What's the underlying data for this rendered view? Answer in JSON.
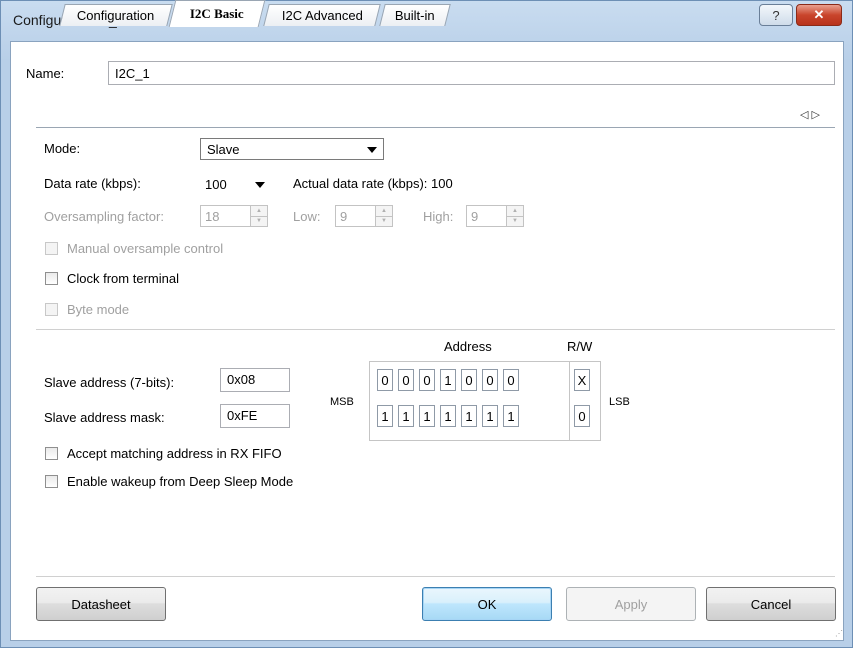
{
  "window": {
    "title": "Configure 'SCB_P4'",
    "help_glyph": "?",
    "close_glyph": "✕"
  },
  "name": {
    "label": "Name:",
    "value": "I2C_1"
  },
  "tabs": [
    {
      "label": "Configuration",
      "active": false
    },
    {
      "label": "I2C Basic",
      "active": true
    },
    {
      "label": "I2C Advanced",
      "active": false
    },
    {
      "label": "Built-in",
      "active": false
    }
  ],
  "tab_nav": {
    "left": "◁",
    "right": "▷"
  },
  "mode": {
    "label": "Mode:",
    "value": "Slave"
  },
  "data_rate": {
    "label": "Data rate (kbps):",
    "value": "100",
    "actual_label": "Actual data rate (kbps): 100"
  },
  "oversampling": {
    "label": "Oversampling factor:",
    "value": "18",
    "low_label": "Low:",
    "low_value": "9",
    "high_label": "High:",
    "high_value": "9"
  },
  "checkboxes": {
    "manual_oversample": "Manual oversample control",
    "clock_from_terminal": "Clock from terminal",
    "byte_mode": "Byte mode",
    "accept_matching": "Accept matching address in RX FIFO",
    "enable_wakeup": "Enable wakeup from Deep Sleep Mode"
  },
  "address": {
    "header_address": "Address",
    "header_rw": "R/W",
    "slave_label": "Slave address (7-bits):",
    "slave_value": "0x08",
    "mask_label": "Slave address mask:",
    "mask_value": "0xFE",
    "msb": "MSB",
    "lsb": "LSB",
    "row1": [
      "0",
      "0",
      "0",
      "1",
      "0",
      "0",
      "0",
      "X"
    ],
    "row2": [
      "1",
      "1",
      "1",
      "1",
      "1",
      "1",
      "1",
      "0"
    ]
  },
  "buttons": {
    "datasheet": "Datasheet",
    "ok": "OK",
    "apply": "Apply",
    "cancel": "Cancel"
  },
  "colors": {
    "title_bar": "#b8cfe8",
    "close": "#c9452c",
    "default_button": "#bee6fd",
    "disabled_text": "#a0a0a0"
  }
}
